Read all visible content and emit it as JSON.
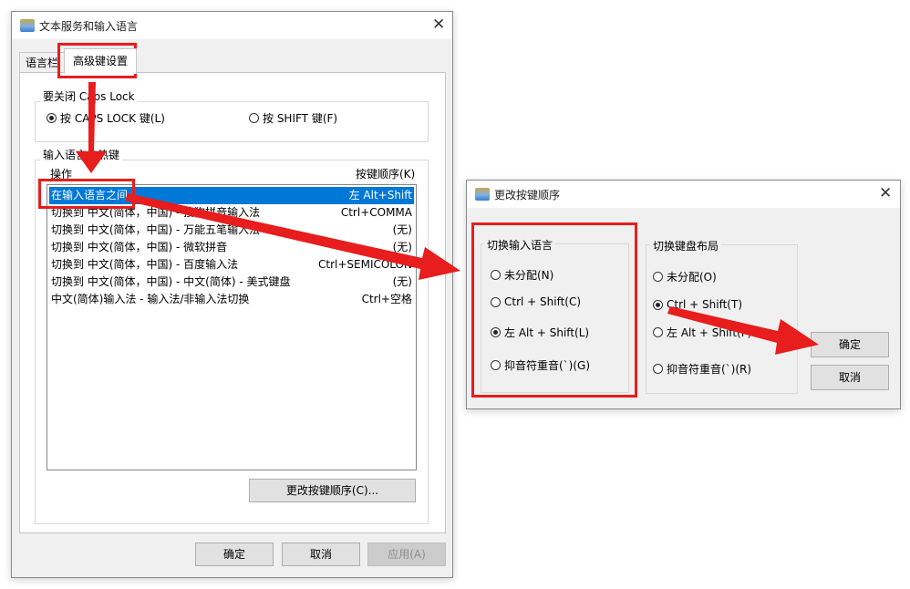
{
  "main_dialog": {
    "title": "文本服务和输入语言",
    "tabs": [
      {
        "label": "语言栏",
        "active": false
      },
      {
        "label": "高级键设置",
        "active": true
      }
    ],
    "caps_group": {
      "title": "要关闭 Caps Lock",
      "options": [
        {
          "label": "按 CAPS LOCK 键(L)",
          "checked": true
        },
        {
          "label": "按 SHIFT 键(F)",
          "checked": false
        }
      ]
    },
    "hotkey_group": {
      "title": "输入语言的热键",
      "col_action": "操作",
      "col_key": "按键顺序(K)",
      "rows": [
        {
          "action": "在输入语言之间",
          "key": "左 Alt+Shift",
          "selected": true
        },
        {
          "action": "切换到 中文(简体，中国) - 搜狗拼音输入法",
          "key": "Ctrl+COMMA",
          "selected": false
        },
        {
          "action": "切换到 中文(简体，中国) - 万能五笔输入法",
          "key": "(无)",
          "selected": false
        },
        {
          "action": "切换到 中文(简体，中国) - 微软拼音",
          "key": "(无)",
          "selected": false
        },
        {
          "action": "切换到 中文(简体，中国) - 百度输入法",
          "key": "Ctrl+SEMICOLON",
          "selected": false
        },
        {
          "action": "切换到 中文(简体，中国) - 中文(简体) - 美式键盘",
          "key": "(无)",
          "selected": false
        },
        {
          "action": "中文(简体)输入法 - 输入法/非输入法切换",
          "key": "Ctrl+空格",
          "selected": false
        }
      ],
      "change_button": "更改按键顺序(C)..."
    },
    "buttons": {
      "ok": "确定",
      "cancel": "取消",
      "apply": "应用(A)"
    }
  },
  "change_dialog": {
    "title": "更改按键顺序",
    "input_lang_group": {
      "title": "切换输入语言",
      "options": [
        {
          "label": "未分配(N)",
          "checked": false
        },
        {
          "label": "Ctrl + Shift(C)",
          "checked": false
        },
        {
          "label": "左 Alt + Shift(L)",
          "checked": true
        },
        {
          "label": "抑音符重音(`)(G)",
          "checked": false
        }
      ]
    },
    "layout_group": {
      "title": "切换键盘布局",
      "options": [
        {
          "label": "未分配(O)",
          "checked": false
        },
        {
          "label": "Ctrl + Shift(T)",
          "checked": true
        },
        {
          "label": "左 Alt + Shift(F)",
          "checked": false
        },
        {
          "label": "抑音符重音(`)(R)",
          "checked": false
        }
      ]
    },
    "buttons": {
      "ok": "确定",
      "cancel": "取消"
    }
  },
  "annotation_color": "#e81d1d"
}
